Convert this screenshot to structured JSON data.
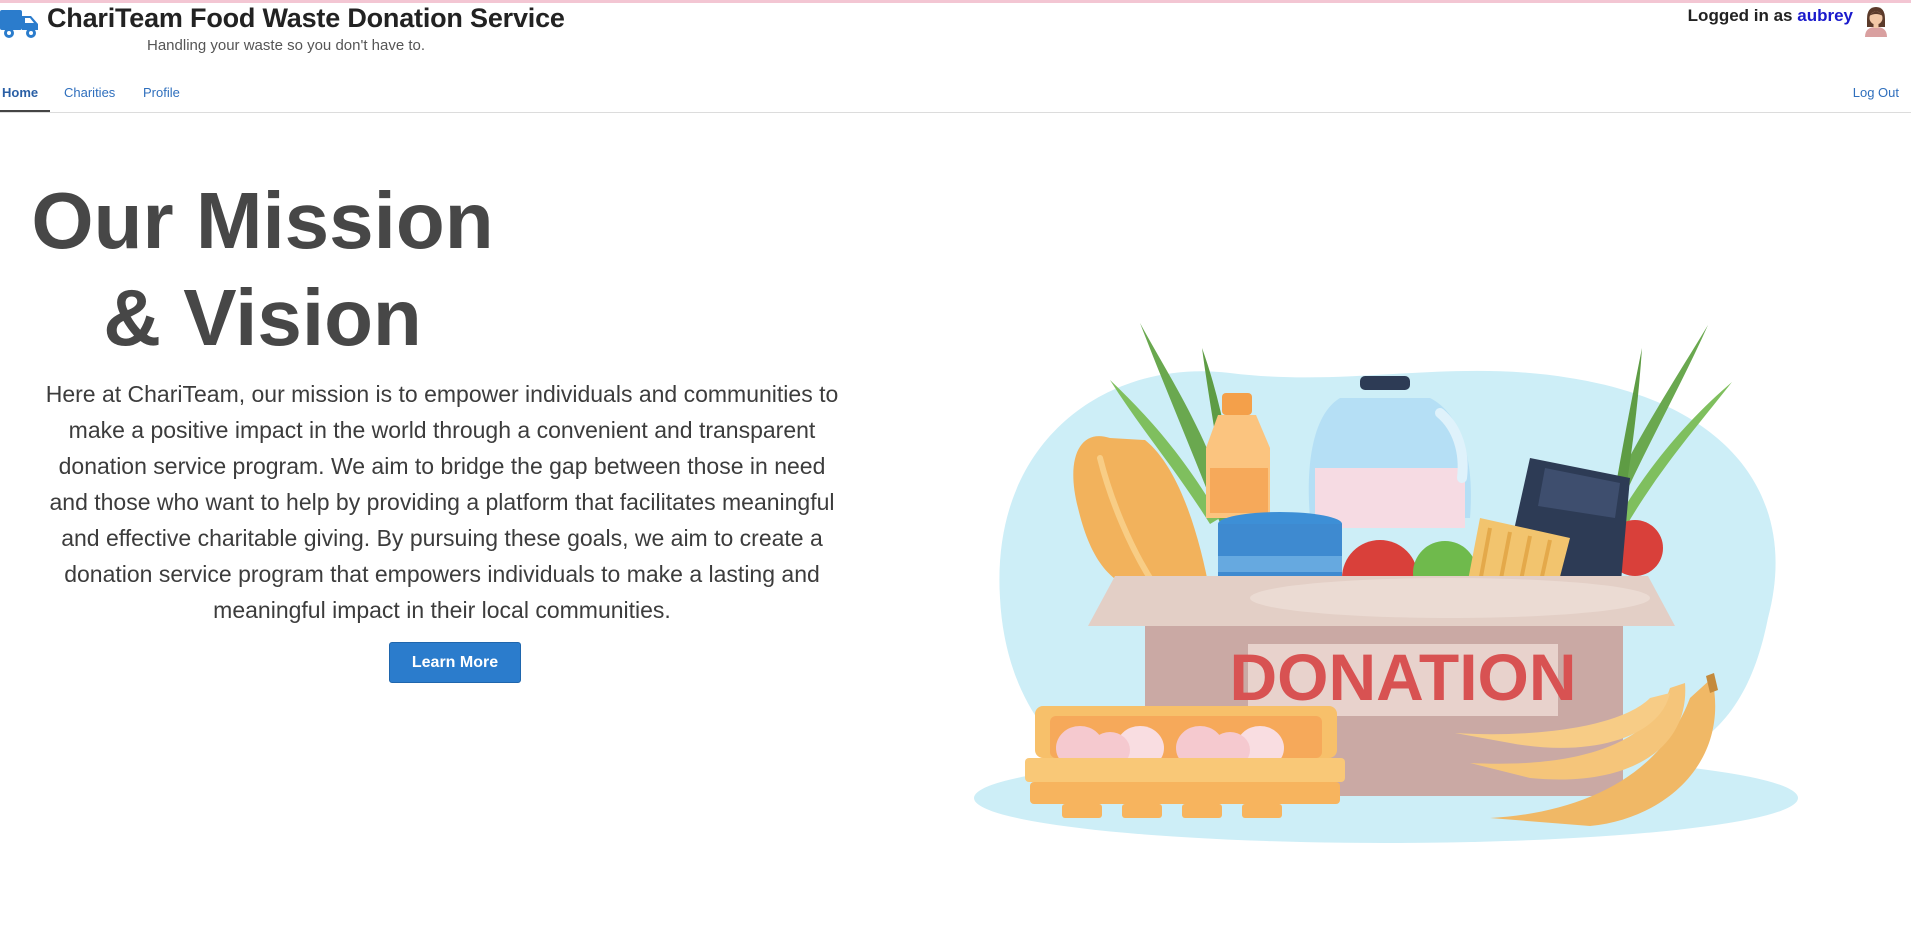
{
  "header": {
    "title": "ChariTeam Food Waste Donation Service",
    "subtitle": "Handling your waste so you don't have to.",
    "logged_in_prefix": "Logged in as",
    "username": "aubrey",
    "logo_icon": "truck-icon",
    "avatar_icon": "user-avatar"
  },
  "nav": {
    "items": [
      {
        "label": "Home",
        "active": true
      },
      {
        "label": "Charities"
      },
      {
        "label": "Profile"
      }
    ],
    "logout": "Log Out"
  },
  "hero": {
    "title_line1": "Our Mission",
    "title_line2": "& Vision",
    "text": "Here at ChariTeam, our mission is to empower individuals and communities to make a positive impact in the world through a convenient and transparent donation service program. We aim to bridge the gap between those in need and those who want to help by providing a platform that facilitates meaningful and effective charitable giving. By pursuing these goals, we aim to create a donation service program that empowers individuals to make a lasting and meaningful impact in their local communities.",
    "button": "Learn More"
  },
  "illustration": {
    "box_label": "DONATION",
    "icon": "donation-box-illustration"
  },
  "colors": {
    "accent": "#2b7ccc",
    "link": "#2f6fbd",
    "username": "#1a1acc",
    "title": "#474747"
  }
}
